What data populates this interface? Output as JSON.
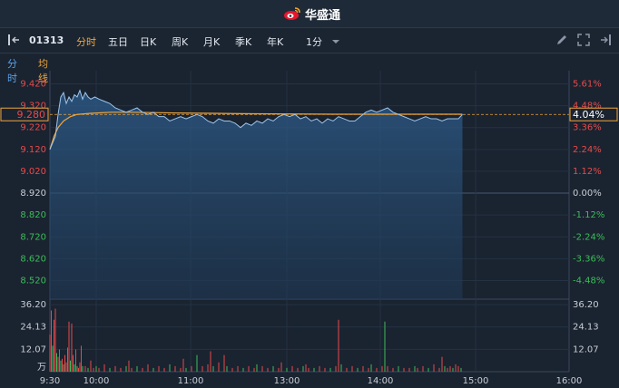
{
  "header": {
    "app_name": "华盛通"
  },
  "toolbar": {
    "symbol": "01313",
    "tabs": [
      {
        "label": "分时",
        "active": true
      },
      {
        "label": "五日",
        "active": false
      },
      {
        "label": "日K",
        "active": false
      },
      {
        "label": "周K",
        "active": false
      },
      {
        "label": "月K",
        "active": false
      },
      {
        "label": "季K",
        "active": false
      },
      {
        "label": "年K",
        "active": false
      }
    ],
    "interval": "1分"
  },
  "legend": {
    "minute": "分时",
    "avg": "均线"
  },
  "colors": {
    "price_line": "#5aa0e6",
    "avg_line": "#f0a53a",
    "up": "#e84a4a",
    "down": "#3dbb5a",
    "neutral": "#c8ced6"
  },
  "chart_data": {
    "type": "line",
    "price_ticks": [
      "9.420",
      "9.320",
      "9.220",
      "9.120",
      "9.020",
      "8.920",
      "8.820",
      "8.720",
      "8.620",
      "8.520"
    ],
    "price_tick_values": [
      9.42,
      9.32,
      9.22,
      9.12,
      9.02,
      8.92,
      8.82,
      8.72,
      8.62,
      8.52
    ],
    "pct_ticks": [
      "5.61%",
      "4.48%",
      "3.36%",
      "2.24%",
      "1.12%",
      "0.00%",
      "-1.12%",
      "-2.24%",
      "-3.36%",
      "-4.48%"
    ],
    "ylim": [
      8.435,
      9.48
    ],
    "prev_close": 8.92,
    "current_price": "9.280",
    "current_pct": "4.04%",
    "volume_ticks": [
      "36.20",
      "24.13",
      "12.07"
    ],
    "volume_unit": "万",
    "volume_max": 36.2,
    "time_ticks": [
      "9:30",
      "10:00",
      "11:00",
      "13:00",
      "14:00",
      "15:00",
      "16:00"
    ],
    "price_series": [
      [
        0,
        9.12
      ],
      [
        2,
        9.15
      ],
      [
        4,
        9.18
      ],
      [
        6,
        9.28
      ],
      [
        8,
        9.36
      ],
      [
        10,
        9.38
      ],
      [
        12,
        9.33
      ],
      [
        14,
        9.36
      ],
      [
        16,
        9.34
      ],
      [
        18,
        9.37
      ],
      [
        20,
        9.36
      ],
      [
        22,
        9.39
      ],
      [
        24,
        9.35
      ],
      [
        26,
        9.38
      ],
      [
        28,
        9.36
      ],
      [
        30,
        9.35
      ],
      [
        33,
        9.36
      ],
      [
        36,
        9.35
      ],
      [
        40,
        9.34
      ],
      [
        44,
        9.33
      ],
      [
        48,
        9.31
      ],
      [
        52,
        9.3
      ],
      [
        56,
        9.29
      ],
      [
        60,
        9.3
      ],
      [
        64,
        9.31
      ],
      [
        68,
        9.29
      ],
      [
        72,
        9.28
      ],
      [
        76,
        9.29
      ],
      [
        80,
        9.27
      ],
      [
        84,
        9.27
      ],
      [
        88,
        9.25
      ],
      [
        92,
        9.26
      ],
      [
        96,
        9.27
      ],
      [
        100,
        9.26
      ],
      [
        104,
        9.27
      ],
      [
        108,
        9.28
      ],
      [
        112,
        9.27
      ],
      [
        116,
        9.25
      ],
      [
        120,
        9.24
      ],
      [
        124,
        9.26
      ],
      [
        128,
        9.25
      ],
      [
        132,
        9.25
      ],
      [
        136,
        9.24
      ],
      [
        140,
        9.22
      ],
      [
        144,
        9.24
      ],
      [
        148,
        9.23
      ],
      [
        152,
        9.25
      ],
      [
        156,
        9.24
      ],
      [
        160,
        9.26
      ],
      [
        164,
        9.25
      ],
      [
        168,
        9.27
      ],
      [
        172,
        9.28
      ],
      [
        176,
        9.27
      ],
      [
        180,
        9.28
      ],
      [
        184,
        9.26
      ],
      [
        188,
        9.27
      ],
      [
        192,
        9.25
      ],
      [
        196,
        9.26
      ],
      [
        200,
        9.24
      ],
      [
        204,
        9.26
      ],
      [
        208,
        9.25
      ],
      [
        212,
        9.27
      ],
      [
        216,
        9.26
      ],
      [
        220,
        9.25
      ],
      [
        224,
        9.25
      ],
      [
        228,
        9.27
      ],
      [
        232,
        9.29
      ],
      [
        236,
        9.3
      ],
      [
        240,
        9.29
      ],
      [
        244,
        9.3
      ],
      [
        248,
        9.31
      ],
      [
        252,
        9.29
      ],
      [
        256,
        9.28
      ],
      [
        260,
        9.27
      ],
      [
        264,
        9.26
      ],
      [
        268,
        9.25
      ],
      [
        272,
        9.26
      ],
      [
        276,
        9.27
      ],
      [
        280,
        9.26
      ],
      [
        284,
        9.26
      ],
      [
        288,
        9.25
      ],
      [
        292,
        9.26
      ],
      [
        296,
        9.26
      ],
      [
        300,
        9.26
      ],
      [
        303,
        9.28
      ]
    ],
    "avg_series": [
      [
        0,
        9.12
      ],
      [
        3,
        9.18
      ],
      [
        6,
        9.22
      ],
      [
        10,
        9.25
      ],
      [
        15,
        9.27
      ],
      [
        20,
        9.28
      ],
      [
        30,
        9.285
      ],
      [
        45,
        9.29
      ],
      [
        60,
        9.29
      ],
      [
        90,
        9.287
      ],
      [
        120,
        9.285
      ],
      [
        150,
        9.283
      ],
      [
        180,
        9.282
      ],
      [
        210,
        9.281
      ],
      [
        240,
        9.281
      ],
      [
        270,
        9.281
      ],
      [
        303,
        9.281
      ]
    ],
    "volume_series": [
      [
        0,
        20,
        "u"
      ],
      [
        1,
        33,
        "u"
      ],
      [
        2,
        14,
        "d"
      ],
      [
        3,
        28,
        "u"
      ],
      [
        4,
        34,
        "u"
      ],
      [
        5,
        10,
        "d"
      ],
      [
        6,
        8,
        "u"
      ],
      [
        7,
        12,
        "u"
      ],
      [
        8,
        6,
        "d"
      ],
      [
        9,
        7,
        "u"
      ],
      [
        10,
        4,
        "d"
      ],
      [
        11,
        9,
        "u"
      ],
      [
        12,
        5,
        "u"
      ],
      [
        13,
        13,
        "u"
      ],
      [
        14,
        27,
        "u"
      ],
      [
        15,
        6,
        "d"
      ],
      [
        16,
        26,
        "u"
      ],
      [
        17,
        9,
        "u"
      ],
      [
        18,
        4,
        "d"
      ],
      [
        19,
        12,
        "u"
      ],
      [
        20,
        3,
        "d"
      ],
      [
        21,
        2,
        "u"
      ],
      [
        22,
        5,
        "u"
      ],
      [
        23,
        14,
        "u"
      ],
      [
        24,
        3,
        "d"
      ],
      [
        26,
        3,
        "u"
      ],
      [
        28,
        2,
        "d"
      ],
      [
        30,
        6,
        "u"
      ],
      [
        32,
        2,
        "u"
      ],
      [
        34,
        3,
        "d"
      ],
      [
        36,
        2,
        "u"
      ],
      [
        40,
        4,
        "u"
      ],
      [
        44,
        2,
        "d"
      ],
      [
        48,
        3,
        "u"
      ],
      [
        52,
        2,
        "u"
      ],
      [
        56,
        3,
        "d"
      ],
      [
        58,
        6,
        "u"
      ],
      [
        60,
        2,
        "u"
      ],
      [
        64,
        3,
        "d"
      ],
      [
        68,
        2,
        "u"
      ],
      [
        72,
        4,
        "u"
      ],
      [
        76,
        2,
        "d"
      ],
      [
        80,
        3,
        "u"
      ],
      [
        84,
        2,
        "u"
      ],
      [
        88,
        4,
        "d"
      ],
      [
        92,
        3,
        "u"
      ],
      [
        96,
        2,
        "u"
      ],
      [
        98,
        7,
        "u"
      ],
      [
        100,
        2,
        "d"
      ],
      [
        104,
        3,
        "u"
      ],
      [
        108,
        9,
        "d"
      ],
      [
        112,
        3,
        "u"
      ],
      [
        116,
        4,
        "u"
      ],
      [
        118,
        11,
        "u"
      ],
      [
        120,
        3,
        "d"
      ],
      [
        124,
        5,
        "u"
      ],
      [
        128,
        9,
        "u"
      ],
      [
        130,
        3,
        "d"
      ],
      [
        134,
        2,
        "u"
      ],
      [
        138,
        3,
        "u"
      ],
      [
        142,
        2,
        "d"
      ],
      [
        146,
        3,
        "u"
      ],
      [
        150,
        2,
        "u"
      ],
      [
        152,
        4,
        "d"
      ],
      [
        156,
        3,
        "u"
      ],
      [
        160,
        2,
        "u"
      ],
      [
        164,
        3,
        "d"
      ],
      [
        168,
        2,
        "u"
      ],
      [
        170,
        5,
        "u"
      ],
      [
        174,
        2,
        "d"
      ],
      [
        178,
        3,
        "u"
      ],
      [
        182,
        2,
        "u"
      ],
      [
        186,
        3,
        "d"
      ],
      [
        188,
        4,
        "u"
      ],
      [
        190,
        2,
        "u"
      ],
      [
        194,
        2,
        "d"
      ],
      [
        198,
        3,
        "u"
      ],
      [
        202,
        2,
        "u"
      ],
      [
        206,
        2,
        "d"
      ],
      [
        210,
        3,
        "u"
      ],
      [
        212,
        28,
        "u"
      ],
      [
        214,
        4,
        "d"
      ],
      [
        218,
        2,
        "u"
      ],
      [
        222,
        3,
        "u"
      ],
      [
        226,
        2,
        "d"
      ],
      [
        230,
        3,
        "u"
      ],
      [
        234,
        2,
        "u"
      ],
      [
        236,
        4,
        "d"
      ],
      [
        240,
        2,
        "u"
      ],
      [
        244,
        3,
        "u"
      ],
      [
        246,
        27,
        "d"
      ],
      [
        248,
        3,
        "u"
      ],
      [
        252,
        2,
        "u"
      ],
      [
        256,
        3,
        "d"
      ],
      [
        260,
        2,
        "u"
      ],
      [
        264,
        2,
        "u"
      ],
      [
        268,
        3,
        "d"
      ],
      [
        270,
        2,
        "u"
      ],
      [
        274,
        3,
        "u"
      ],
      [
        278,
        2,
        "d"
      ],
      [
        282,
        4,
        "u"
      ],
      [
        286,
        2,
        "u"
      ],
      [
        288,
        8,
        "u"
      ],
      [
        290,
        3,
        "d"
      ],
      [
        292,
        2,
        "u"
      ],
      [
        294,
        3,
        "u"
      ],
      [
        296,
        2,
        "d"
      ],
      [
        298,
        4,
        "u"
      ],
      [
        300,
        3,
        "u"
      ],
      [
        302,
        2,
        "d"
      ]
    ]
  }
}
